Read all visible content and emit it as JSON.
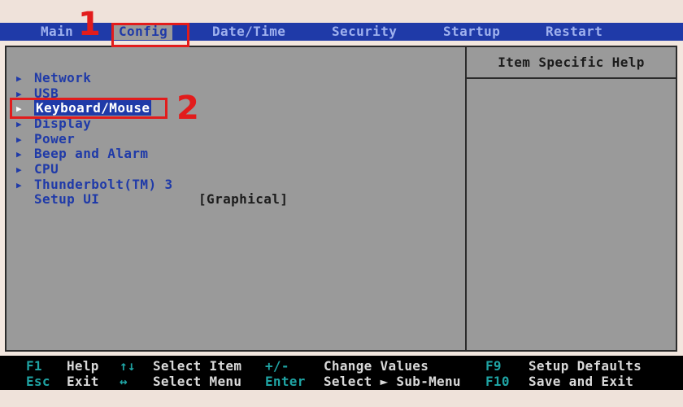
{
  "menubar": {
    "tabs": [
      {
        "label": "Main"
      },
      {
        "label": "Config"
      },
      {
        "label": "Date/Time"
      },
      {
        "label": "Security"
      },
      {
        "label": "Startup"
      },
      {
        "label": "Restart"
      }
    ],
    "active_tab": "Config"
  },
  "config_menu": {
    "items": [
      {
        "label": "Network"
      },
      {
        "label": "USB"
      },
      {
        "label": "Keyboard/Mouse"
      },
      {
        "label": "Display"
      },
      {
        "label": "Power"
      },
      {
        "label": "Beep and Alarm"
      },
      {
        "label": "CPU"
      },
      {
        "label": "Thunderbolt(TM) 3"
      }
    ],
    "selected_item": "Keyboard/Mouse",
    "setup_ui": {
      "label": "Setup UI",
      "value": "[Graphical]"
    }
  },
  "help_panel": {
    "title": "Item Specific Help"
  },
  "annotations": {
    "step1": "1",
    "step2": "2"
  },
  "footer": {
    "row1": [
      {
        "key": "F1",
        "label": "Help"
      },
      {
        "key": "↑↓",
        "label": "Select Item"
      },
      {
        "key": "+/-",
        "label": "Change Values"
      },
      {
        "key": "F9",
        "label": "Setup Defaults"
      }
    ],
    "row2": [
      {
        "key": "Esc",
        "label": "Exit"
      },
      {
        "key": "↔",
        "label": "Select Menu"
      },
      {
        "key": "Enter",
        "label": "Select ► Sub-Menu"
      },
      {
        "key": "F10",
        "label": "Save and Exit"
      }
    ]
  },
  "colors": {
    "bios_blue": "#1f3aa8",
    "panel_gray": "#9a9a9a",
    "annotation_red": "#e21c1c",
    "footer_key_cyan": "#1fa3a3"
  },
  "icons": {
    "submenu_arrow": "triangle-right-icon"
  }
}
